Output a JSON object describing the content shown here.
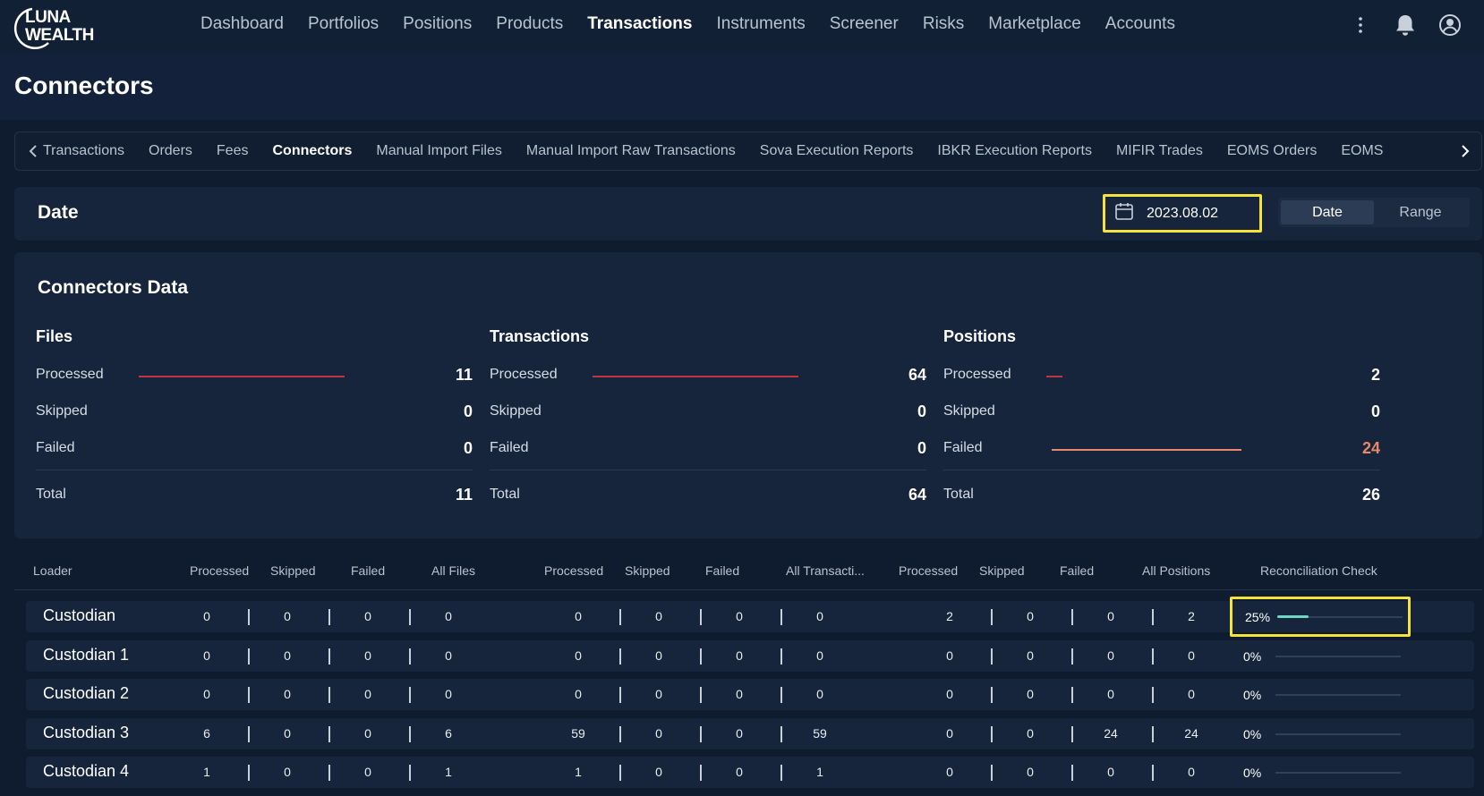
{
  "brand": {
    "line1": "LUNA",
    "line2": "WEALTH"
  },
  "nav": [
    "Dashboard",
    "Portfolios",
    "Positions",
    "Products",
    "Transactions",
    "Instruments",
    "Screener",
    "Risks",
    "Marketplace",
    "Accounts"
  ],
  "nav_active": "Transactions",
  "page_title": "Connectors",
  "subtabs": [
    "Transactions",
    "Orders",
    "Fees",
    "Connectors",
    "Manual Import Files",
    "Manual Import Raw Transactions",
    "Sova Execution Reports",
    "IBKR Execution Reports",
    "MIFIR Trades",
    "EOMS Orders",
    "EOMS"
  ],
  "subtab_active": "Connectors",
  "date_section": {
    "label": "Date",
    "value": "2023.08.02",
    "modes": [
      "Date",
      "Range"
    ]
  },
  "connectors_data": {
    "title": "Connectors Data",
    "groups": [
      {
        "title": "Files",
        "processed": "11",
        "skipped": "0",
        "failed": "0",
        "total": "11",
        "processed_frac": 1.0,
        "failed_frac": 0
      },
      {
        "title": "Transactions",
        "processed": "64",
        "skipped": "0",
        "failed": "0",
        "total": "64",
        "processed_frac": 1.0,
        "failed_frac": 0
      },
      {
        "title": "Positions",
        "processed": "2",
        "skipped": "0",
        "failed": "24",
        "total": "26",
        "processed_frac": 0.077,
        "failed_frac": 0.923
      }
    ],
    "labels": {
      "processed": "Processed",
      "skipped": "Skipped",
      "failed": "Failed",
      "total": "Total"
    }
  },
  "table": {
    "headers": [
      "Loader",
      "Processed",
      "Skipped",
      "Failed",
      "All Files",
      "Processed",
      "Skipped",
      "Failed",
      "All Transacti...",
      "Processed",
      "Skipped",
      "Failed",
      "All Positions",
      "Reconciliation Check"
    ],
    "rows": [
      {
        "name": "Custodian",
        "values": [
          "0",
          "0",
          "0",
          "0",
          "0",
          "0",
          "0",
          "0",
          "2",
          "0",
          "0",
          "2"
        ],
        "recon": "25%",
        "recon_frac": 0.25
      },
      {
        "name": "Custodian 1",
        "values": [
          "0",
          "0",
          "0",
          "0",
          "0",
          "0",
          "0",
          "0",
          "0",
          "0",
          "0",
          "0"
        ],
        "recon": "0%",
        "recon_frac": 0
      },
      {
        "name": "Custodian 2",
        "values": [
          "0",
          "0",
          "0",
          "0",
          "0",
          "0",
          "0",
          "0",
          "0",
          "0",
          "0",
          "0"
        ],
        "recon": "0%",
        "recon_frac": 0
      },
      {
        "name": "Custodian 3",
        "values": [
          "6",
          "0",
          "0",
          "6",
          "59",
          "0",
          "0",
          "59",
          "0",
          "0",
          "24",
          "24"
        ],
        "recon": "0%",
        "recon_frac": 0
      },
      {
        "name": "Custodian 4",
        "values": [
          "1",
          "0",
          "0",
          "1",
          "1",
          "0",
          "0",
          "1",
          "0",
          "0",
          "0",
          "0"
        ],
        "recon": "0%",
        "recon_frac": 0
      }
    ]
  },
  "colors": {
    "processed_bar": "#c0363e",
    "failed_bar": "#e8886b",
    "recon_fill": "#6ed7c3",
    "highlight": "#f5e33b"
  },
  "icons": [
    "more-vertical-icon",
    "bell-icon",
    "user-circle-icon",
    "calendar-icon",
    "chevron-left-icon",
    "chevron-right-icon"
  ]
}
